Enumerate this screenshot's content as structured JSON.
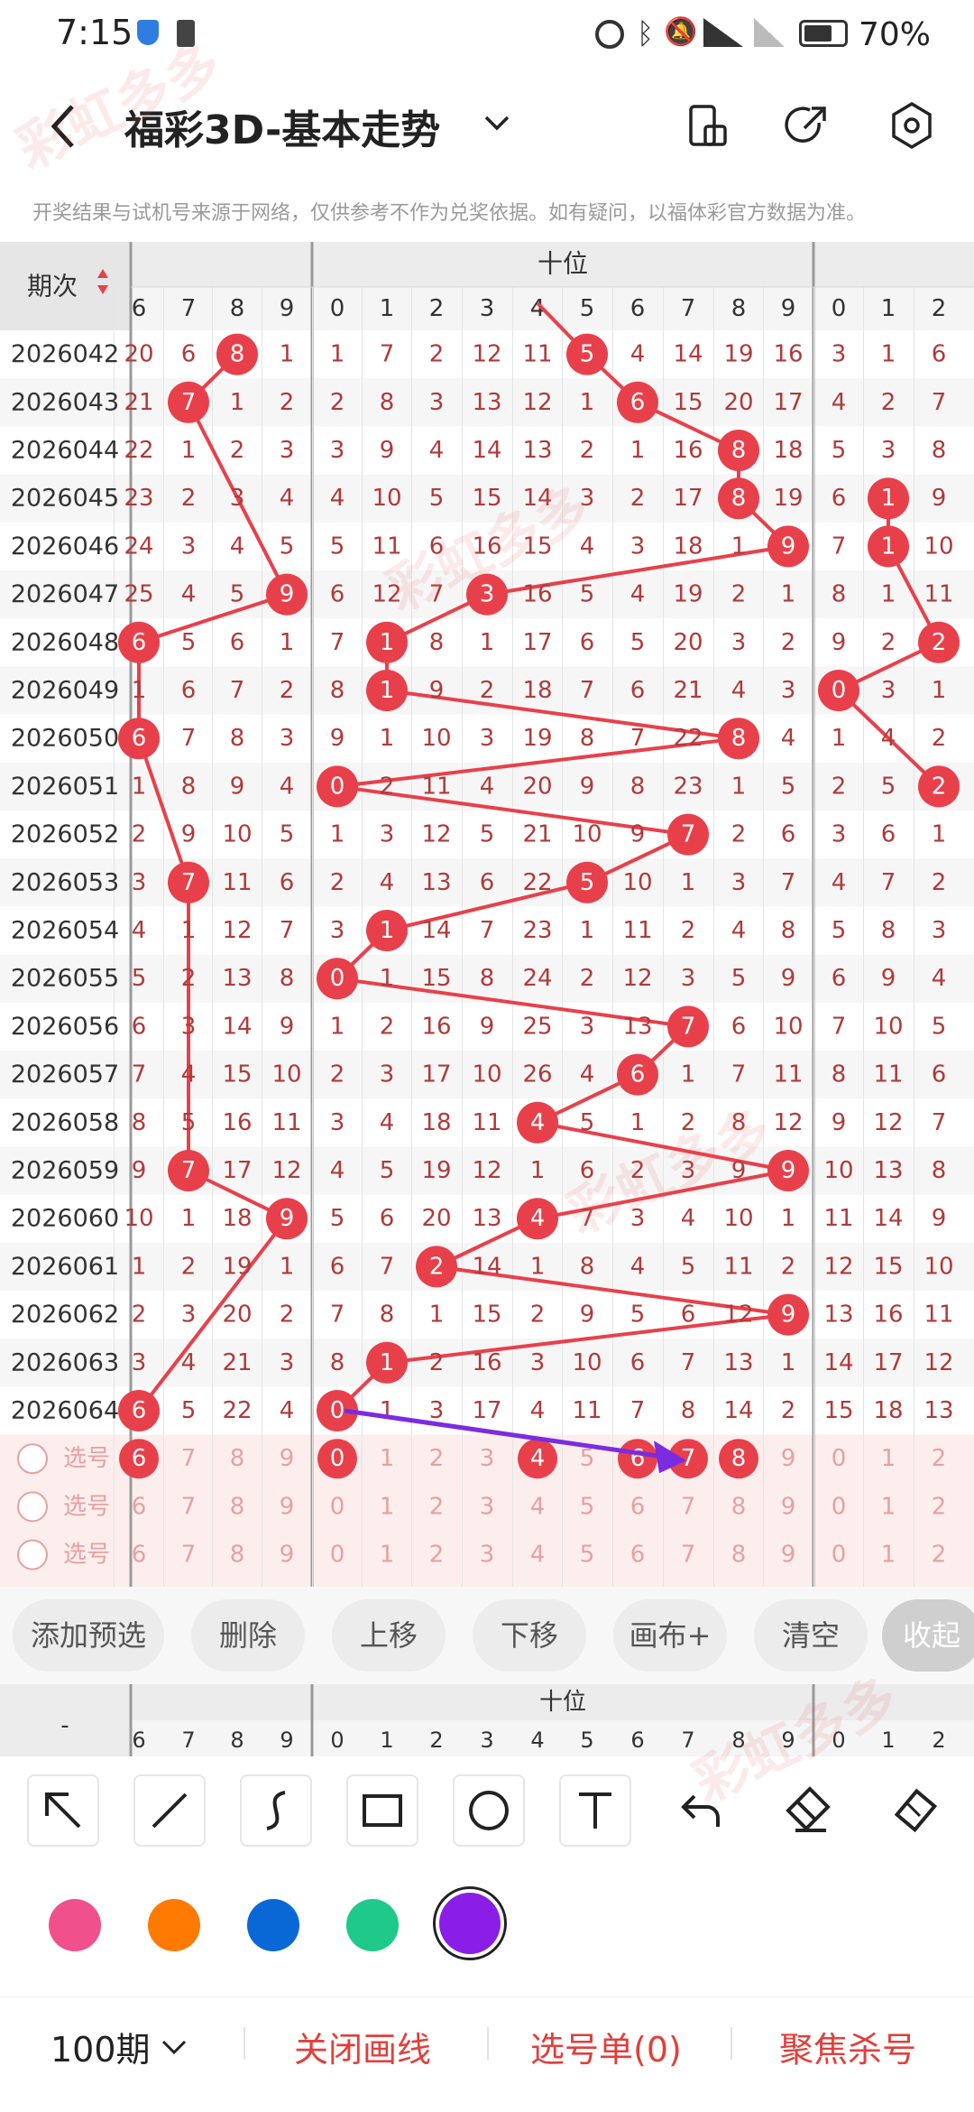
{
  "status": {
    "time": "7:15",
    "battery": "70%"
  },
  "header": {
    "title": "福彩3D-基本走势"
  },
  "notice": "开奖结果与试机号来源于网络，仅供参考不作为兑奖依据。如有疑问，以福体彩官方数据为准。",
  "table": {
    "period_header": "期次",
    "group_header": "十位",
    "left_cols": [
      "6",
      "7",
      "8",
      "9"
    ],
    "mid_cols": [
      "0",
      "1",
      "2",
      "3",
      "4",
      "5",
      "6",
      "7",
      "8",
      "9"
    ],
    "right_cols": [
      "0",
      "1",
      "2"
    ],
    "rows": [
      {
        "period": "2026042",
        "left": [
          "20",
          "6",
          "8",
          "1"
        ],
        "hl": 2,
        "mid": [
          "1",
          "7",
          "2",
          "12",
          "11",
          "5",
          "4",
          "14",
          "19",
          "16"
        ],
        "tens": 5,
        "right": [
          "3",
          "1",
          "6"
        ],
        "rh": -1
      },
      {
        "period": "2026043",
        "left": [
          "21",
          "7",
          "1",
          "2"
        ],
        "hl": 1,
        "mid": [
          "2",
          "8",
          "3",
          "13",
          "12",
          "1",
          "6",
          "15",
          "20",
          "17"
        ],
        "tens": 6,
        "right": [
          "4",
          "2",
          "7"
        ],
        "rh": -1
      },
      {
        "period": "2026044",
        "left": [
          "22",
          "1",
          "2",
          "3"
        ],
        "hl": -1,
        "mid": [
          "3",
          "9",
          "4",
          "14",
          "13",
          "2",
          "1",
          "16",
          "8",
          "18"
        ],
        "tens": 8,
        "right": [
          "5",
          "3",
          "8"
        ],
        "rh": -1
      },
      {
        "period": "2026045",
        "left": [
          "23",
          "2",
          "3",
          "4"
        ],
        "hl": -1,
        "mid": [
          "4",
          "10",
          "5",
          "15",
          "14",
          "3",
          "2",
          "17",
          "8",
          "19"
        ],
        "tens": 8,
        "right": [
          "6",
          "1",
          "9"
        ],
        "rh": 1
      },
      {
        "period": "2026046",
        "left": [
          "24",
          "3",
          "4",
          "5"
        ],
        "hl": -1,
        "mid": [
          "5",
          "11",
          "6",
          "16",
          "15",
          "4",
          "3",
          "18",
          "1",
          "9"
        ],
        "tens": 9,
        "right": [
          "7",
          "1",
          "10"
        ],
        "rh": 1
      },
      {
        "period": "2026047",
        "left": [
          "25",
          "4",
          "5",
          "9"
        ],
        "hl": 3,
        "mid": [
          "6",
          "12",
          "7",
          "3",
          "16",
          "5",
          "4",
          "19",
          "2",
          "1"
        ],
        "tens": 3,
        "right": [
          "8",
          "1",
          "11"
        ],
        "rh": -1
      },
      {
        "period": "2026048",
        "left": [
          "6",
          "5",
          "6",
          "1"
        ],
        "hl": 0,
        "mid": [
          "7",
          "1",
          "8",
          "1",
          "17",
          "6",
          "5",
          "20",
          "3",
          "2"
        ],
        "tens": 1,
        "right": [
          "9",
          "2",
          "2"
        ],
        "rh": 2
      },
      {
        "period": "2026049",
        "left": [
          "1",
          "6",
          "7",
          "2"
        ],
        "hl": -1,
        "mid": [
          "8",
          "1",
          "9",
          "2",
          "18",
          "7",
          "6",
          "21",
          "4",
          "3"
        ],
        "tens": 1,
        "right": [
          "0",
          "3",
          "1"
        ],
        "rh": 0
      },
      {
        "period": "2026050",
        "left": [
          "6",
          "7",
          "8",
          "3"
        ],
        "hl": 0,
        "mid": [
          "9",
          "1",
          "10",
          "3",
          "19",
          "8",
          "7",
          "22",
          "8",
          "4"
        ],
        "tens": 8,
        "right": [
          "1",
          "4",
          "2"
        ],
        "rh": -1
      },
      {
        "period": "2026051",
        "left": [
          "1",
          "8",
          "9",
          "4"
        ],
        "hl": -1,
        "mid": [
          "0",
          "2",
          "11",
          "4",
          "20",
          "9",
          "8",
          "23",
          "1",
          "5"
        ],
        "tens": 0,
        "right": [
          "2",
          "5",
          "2"
        ],
        "rh": 2
      },
      {
        "period": "2026052",
        "left": [
          "2",
          "9",
          "10",
          "5"
        ],
        "hl": -1,
        "mid": [
          "1",
          "3",
          "12",
          "5",
          "21",
          "10",
          "9",
          "7",
          "2",
          "6"
        ],
        "tens": 7,
        "right": [
          "3",
          "6",
          "1"
        ],
        "rh": -1
      },
      {
        "period": "2026053",
        "left": [
          "3",
          "7",
          "11",
          "6"
        ],
        "hl": 1,
        "mid": [
          "2",
          "4",
          "13",
          "6",
          "22",
          "5",
          "10",
          "1",
          "3",
          "7"
        ],
        "tens": 5,
        "right": [
          "4",
          "7",
          "2"
        ],
        "rh": -1
      },
      {
        "period": "2026054",
        "left": [
          "4",
          "1",
          "12",
          "7"
        ],
        "hl": -1,
        "mid": [
          "3",
          "1",
          "14",
          "7",
          "23",
          "1",
          "11",
          "2",
          "4",
          "8"
        ],
        "tens": 1,
        "right": [
          "5",
          "8",
          "3"
        ],
        "rh": -1
      },
      {
        "period": "2026055",
        "left": [
          "5",
          "2",
          "13",
          "8"
        ],
        "hl": -1,
        "mid": [
          "0",
          "1",
          "15",
          "8",
          "24",
          "2",
          "12",
          "3",
          "5",
          "9"
        ],
        "tens": 0,
        "right": [
          "6",
          "9",
          "4"
        ],
        "rh": -1
      },
      {
        "period": "2026056",
        "left": [
          "6",
          "3",
          "14",
          "9"
        ],
        "hl": -1,
        "mid": [
          "1",
          "2",
          "16",
          "9",
          "25",
          "3",
          "13",
          "7",
          "6",
          "10"
        ],
        "tens": 7,
        "right": [
          "7",
          "10",
          "5"
        ],
        "rh": -1
      },
      {
        "period": "2026057",
        "left": [
          "7",
          "4",
          "15",
          "10"
        ],
        "hl": -1,
        "mid": [
          "2",
          "3",
          "17",
          "10",
          "26",
          "4",
          "6",
          "1",
          "7",
          "11"
        ],
        "tens": 6,
        "right": [
          "8",
          "11",
          "6"
        ],
        "rh": -1
      },
      {
        "period": "2026058",
        "left": [
          "8",
          "5",
          "16",
          "11"
        ],
        "hl": -1,
        "mid": [
          "3",
          "4",
          "18",
          "11",
          "4",
          "5",
          "1",
          "2",
          "8",
          "12"
        ],
        "tens": 4,
        "right": [
          "9",
          "12",
          "7"
        ],
        "rh": -1
      },
      {
        "period": "2026059",
        "left": [
          "9",
          "7",
          "17",
          "12"
        ],
        "hl": 1,
        "mid": [
          "4",
          "5",
          "19",
          "12",
          "1",
          "6",
          "2",
          "3",
          "9",
          "9"
        ],
        "tens": 9,
        "right": [
          "10",
          "13",
          "8"
        ],
        "rh": -1
      },
      {
        "period": "2026060",
        "left": [
          "10",
          "1",
          "18",
          "9"
        ],
        "hl": 3,
        "mid": [
          "5",
          "6",
          "20",
          "13",
          "4",
          "7",
          "3",
          "4",
          "10",
          "1"
        ],
        "tens": 4,
        "right": [
          "11",
          "14",
          "9"
        ],
        "rh": -1
      },
      {
        "period": "2026061",
        "left": [
          "1",
          "2",
          "19",
          "1"
        ],
        "hl": -1,
        "mid": [
          "6",
          "7",
          "2",
          "14",
          "1",
          "8",
          "4",
          "5",
          "11",
          "2"
        ],
        "tens": 2,
        "right": [
          "12",
          "15",
          "10"
        ],
        "rh": -1
      },
      {
        "period": "2026062",
        "left": [
          "2",
          "3",
          "20",
          "2"
        ],
        "hl": -1,
        "mid": [
          "7",
          "8",
          "1",
          "15",
          "2",
          "9",
          "5",
          "6",
          "12",
          "9"
        ],
        "tens": 9,
        "right": [
          "13",
          "16",
          "11"
        ],
        "rh": -1
      },
      {
        "period": "2026063",
        "left": [
          "3",
          "4",
          "21",
          "3"
        ],
        "hl": -1,
        "mid": [
          "8",
          "1",
          "2",
          "16",
          "3",
          "10",
          "6",
          "7",
          "13",
          "1"
        ],
        "tens": 1,
        "right": [
          "14",
          "17",
          "12"
        ],
        "rh": -1
      },
      {
        "period": "2026064",
        "left": [
          "6",
          "5",
          "22",
          "4"
        ],
        "hl": 0,
        "mid": [
          "0",
          "1",
          "3",
          "17",
          "4",
          "11",
          "7",
          "8",
          "14",
          "2"
        ],
        "tens": 0,
        "right": [
          "15",
          "18",
          "13"
        ],
        "rh": -1
      }
    ],
    "select_label": "选号",
    "select_rows": [
      {
        "left": [
          "6",
          "7",
          "8",
          "9"
        ],
        "lsel": [
          0
        ],
        "mid": [
          "0",
          "1",
          "2",
          "3",
          "4",
          "5",
          "6",
          "7",
          "8",
          "9"
        ],
        "msel": [
          0,
          4,
          6,
          7,
          8
        ],
        "right": [
          "0",
          "1",
          "2"
        ]
      },
      {
        "left": [
          "6",
          "7",
          "8",
          "9"
        ],
        "lsel": [],
        "mid": [
          "0",
          "1",
          "2",
          "3",
          "4",
          "5",
          "6",
          "7",
          "8",
          "9"
        ],
        "msel": [],
        "right": [
          "0",
          "1",
          "2"
        ]
      },
      {
        "left": [
          "6",
          "7",
          "8",
          "9"
        ],
        "lsel": [],
        "mid": [
          "0",
          "1",
          "2",
          "3",
          "4",
          "5",
          "6",
          "7",
          "8",
          "9"
        ],
        "msel": [],
        "right": [
          "0",
          "1",
          "2"
        ]
      }
    ]
  },
  "actions": [
    "添加预选",
    "删除",
    "上移",
    "下移",
    "画布+",
    "清空",
    "收起"
  ],
  "footer_table": {
    "period_header": "-",
    "group_header": "十位"
  },
  "draw_tools": [
    "arrow-tool-icon",
    "line-tool-icon",
    "curve-tool-icon",
    "rect-tool-icon",
    "circle-tool-icon",
    "text-tool-icon",
    "undo-icon",
    "eraser-icon",
    "clear-canvas-icon"
  ],
  "colors": {
    "pink": "#f0508c",
    "orange": "#ff7a00",
    "blue": "#0a68d6",
    "green": "#1ec98a",
    "purple": "#8a1ee6",
    "ball": "#e8404a",
    "line": "#e8404a",
    "arrow": "#7b2be0",
    "accent": "#e0403c"
  },
  "bottom": {
    "period_select": "100期",
    "close_draw": "关闭画线",
    "pick_list": "选号单(0)",
    "focus_kill": "聚焦杀号"
  },
  "watermark": "彩虹多多"
}
